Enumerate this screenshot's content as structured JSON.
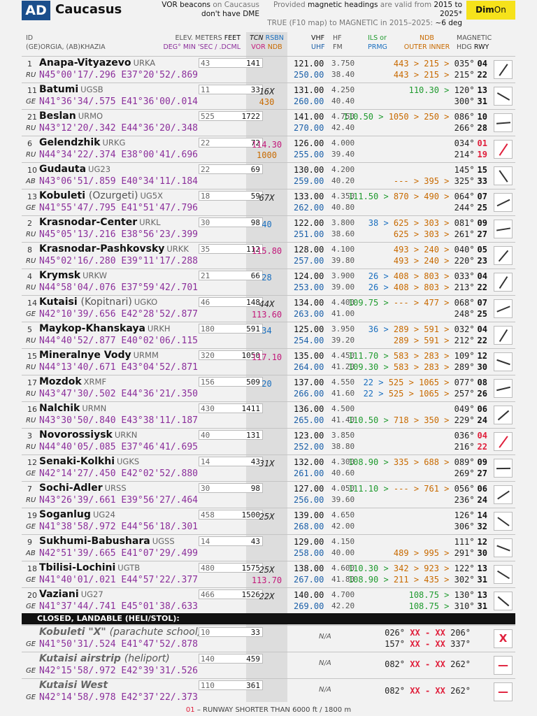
{
  "header": {
    "code": "AD",
    "title": "Caucasus",
    "vor_note_a": "VOR beacons",
    "vor_note_b": " on Caucasus",
    "vor_note_c": "don't have DME",
    "mag_note_a": "Provided ",
    "mag_note_b": "magnetic headings",
    "mag_note_c": " are valid from ",
    "mag_note_d": "2015 to 2025*",
    "mag_note_e": "TRUE (F10 map) to MAGNETIC in 2015–2025: ",
    "mag_note_f": "~6 deg",
    "dim_a": "Dim",
    "dim_b": "On"
  },
  "columns": {
    "id": "ID",
    "region": "(GE)ORGIA, (AB)KHAZIA",
    "elev": "ELEV. METERS",
    "feet": "FEET",
    "deg": "DEG° MIN 'SEC / .DCML",
    "tcn": "TCN",
    "rsbn": "RSBN",
    "vor": "VOR",
    "ndb": "NDB",
    "vhf": "VHF",
    "uhf": "UHF",
    "hf": "HF",
    "fm": "FM",
    "ils": "ILS or",
    "prmg": "PRMG",
    "ndb2": "NDB",
    "outer": "OUTER",
    "inner": "INNER",
    "magnetic": "MAGNETIC",
    "hdg": "HDG",
    "rwy": "RWY"
  },
  "airfields": [
    {
      "idx": "1",
      "name": "Anapa-Vityazevo",
      "icao": "URKA",
      "cc": "RU",
      "coord": "N45°00'17/.296  E37°20'52/.869",
      "m": "43",
      "ft": "141",
      "tcn": "",
      "rsbn": "",
      "vor": "",
      "ndb": "",
      "vhf": "121.00",
      "uhf": "250.00",
      "hf": "3.750",
      "fm": "38.40",
      "l1": "443 > 215 > 035°",
      "r1": "04",
      "l2": "443 > 215 > 215°",
      "r2": "22"
    },
    {
      "idx": "11",
      "name": "Batumi",
      "icao": "UGSB",
      "cc": "GE",
      "coord": "N41°36'34/.575  E41°36'00/.014",
      "m": "11",
      "ft": "33",
      "tcn": "16X",
      "rsbn": "",
      "vor": "",
      "ndb": "430",
      "vhf": "131.00",
      "uhf": "260.00",
      "hf": "4.250",
      "fm": "40.40",
      "l1": "110.30 > 120°",
      "r1": "13",
      "l2": "300°",
      "r2": "31"
    },
    {
      "idx": "21",
      "name": "Beslan",
      "icao": "URMO",
      "cc": "RU",
      "coord": "N43°12'20/.342  E44°36'20/.348",
      "m": "525",
      "ft": "1722",
      "tcn": "",
      "rsbn": "",
      "vor": "",
      "ndb": "",
      "vhf": "141.00",
      "uhf": "270.00",
      "hf": "4.750",
      "fm": "42.40",
      "l1": "110.50 > 1050 > 250 > 086°",
      "r1": "10",
      "l2": "266°",
      "r2": "28"
    },
    {
      "idx": "6",
      "name": "Gelendzhik",
      "icao": "URKG",
      "cc": "RU",
      "coord": "N44°34'22/.374  E38°00'41/.696",
      "m": "22",
      "ft": "72",
      "tcn": "",
      "rsbn": "",
      "vor": "114.30",
      "ndb": "1000",
      "vhf": "126.00",
      "uhf": "255.00",
      "hf": "4.000",
      "fm": "39.40",
      "l1": "034°",
      "r1": "01",
      "l2": "214°",
      "r2": "19",
      "short": true
    },
    {
      "idx": "10",
      "name": "Gudauta",
      "icao": "UG23",
      "cc": "AB",
      "coord": "N43°06'51/.859  E40°34'11/.184",
      "m": "22",
      "ft": "69",
      "tcn": "",
      "rsbn": "",
      "vor": "",
      "ndb": "",
      "vhf": "130.00",
      "uhf": "259.00",
      "hf": "4.200",
      "fm": "40.20",
      "l1": "145°",
      "r1": "15",
      "l2": "--- > 395 > 325°",
      "r2": "33"
    },
    {
      "idx": "13",
      "name": "Kobuleti",
      "alt": "(Ozurgeti)",
      "icao": "UG5X",
      "cc": "GE",
      "coord": "N41°55'47/.795  E41°51'47/.796",
      "m": "18",
      "ft": "59",
      "tcn": "67X",
      "rsbn": "",
      "vor": "",
      "ndb": "",
      "vhf": "133.00",
      "uhf": "262.00",
      "hf": "4.350",
      "fm": "40.80",
      "l1": "111.50 > 870 > 490 > 064°",
      "r1": "07",
      "l2": "244°",
      "r2": "25"
    },
    {
      "idx": "2",
      "name": "Krasnodar-Center",
      "icao": "URKL",
      "cc": "RU",
      "coord": "N45°05'13/.216  E38°56'23/.399",
      "m": "30",
      "ft": "98",
      "tcn": "",
      "rsbn": "40",
      "vor": "",
      "ndb": "",
      "vhf": "122.00",
      "uhf": "251.00",
      "hf": "3.800",
      "fm": "38.60",
      "l1": "38 > 625 > 303 > 081°",
      "r1": "09",
      "l2": "625 > 303 > 261°",
      "r2": "27"
    },
    {
      "idx": "8",
      "name": "Krasnodar-Pashkovsky",
      "icao": "URKK",
      "cc": "RU",
      "coord": "N45°02'16/.280  E39°11'17/.288",
      "m": "35",
      "ft": "112",
      "tcn": "",
      "rsbn": "",
      "vor": "115.80",
      "ndb": "",
      "vhf": "128.00",
      "uhf": "257.00",
      "hf": "4.100",
      "fm": "39.80",
      "l1": "493 > 240 > 040°",
      "r1": "05",
      "l2": "493 > 240 > 220°",
      "r2": "23"
    },
    {
      "idx": "4",
      "name": "Krymsk",
      "icao": "URKW",
      "cc": "RU",
      "coord": "N44°58'04/.076  E37°59'42/.701",
      "m": "21",
      "ft": "66",
      "tcn": "",
      "rsbn": "28",
      "vor": "",
      "ndb": "",
      "vhf": "124.00",
      "uhf": "253.00",
      "hf": "3.900",
      "fm": "39.00",
      "l1": "26 > 408 > 803 > 033°",
      "r1": "04",
      "l2": "26 > 408 > 803 > 213°",
      "r2": "22"
    },
    {
      "idx": "14",
      "name": "Kutaisi",
      "alt": "(Kopitnari)",
      "icao": "UGKO",
      "cc": "GE",
      "coord": "N42°10'39/.656  E42°28'52/.877",
      "m": "46",
      "ft": "148",
      "tcn": "44X",
      "rsbn": "",
      "vor": "113.60",
      "ndb": "",
      "vhf": "134.00",
      "uhf": "263.00",
      "hf": "4.400",
      "fm": "41.00",
      "l1": "109.75 > --- > 477 > 068°",
      "r1": "07",
      "l2": "248°",
      "r2": "25"
    },
    {
      "idx": "5",
      "name": "Maykop-Khanskaya",
      "icao": "URKH",
      "cc": "RU",
      "coord": "N44°40'52/.877  E40°02'06/.115",
      "m": "180",
      "ft": "591",
      "tcn": "",
      "rsbn": "34",
      "vor": "",
      "ndb": "",
      "vhf": "125.00",
      "uhf": "254.00",
      "hf": "3.950",
      "fm": "39.20",
      "l1": "36 > 289 > 591 > 032°",
      "r1": "04",
      "l2": "289 > 591 > 212°",
      "r2": "22"
    },
    {
      "idx": "15",
      "name": "Mineralnye Vody",
      "icao": "URMM",
      "cc": "RU",
      "coord": "N44°13'40/.671  E43°04'52/.871",
      "m": "320",
      "ft": "1050",
      "tcn": "",
      "rsbn": "",
      "vor": "117.10",
      "ndb": "",
      "vhf": "135.00",
      "uhf": "264.00",
      "hf": "4.450",
      "fm": "41.20",
      "l1": "111.70 > 583 > 283 > 109°",
      "r1": "12",
      "l2": "109.30 > 583 > 283 > 289°",
      "r2": "30"
    },
    {
      "idx": "17",
      "name": "Mozdok",
      "icao": "XRMF",
      "cc": "RU",
      "coord": "N43°47'30/.502  E44°36'21/.350",
      "m": "156",
      "ft": "509",
      "tcn": "",
      "rsbn": "20",
      "vor": "",
      "ndb": "",
      "vhf": "137.00",
      "uhf": "266.00",
      "hf": "4.550",
      "fm": "41.60",
      "l1": "22 > 525 > 1065 > 077°",
      "r1": "08",
      "l2": "22 > 525 > 1065 > 257°",
      "r2": "26"
    },
    {
      "idx": "16",
      "name": "Nalchik",
      "icao": "URMN",
      "cc": "RU",
      "coord": "N43°30'50/.840  E43°38'11/.187",
      "m": "430",
      "ft": "1411",
      "tcn": "",
      "rsbn": "",
      "vor": "",
      "ndb": "",
      "vhf": "136.00",
      "uhf": "265.00",
      "hf": "4.500",
      "fm": "41.40",
      "l1": "049°",
      "r1": "06",
      "l2": "110.50 > 718 > 350 > 229°",
      "r2": "24"
    },
    {
      "idx": "3",
      "name": "Novorossiysk",
      "icao": "URKN",
      "cc": "RU",
      "coord": "N44°40'05/.085  E37°46'41/.695",
      "m": "40",
      "ft": "131",
      "tcn": "",
      "rsbn": "",
      "vor": "",
      "ndb": "",
      "vhf": "123.00",
      "uhf": "252.00",
      "hf": "3.850",
      "fm": "38.80",
      "l1": "036°",
      "r1": "04",
      "l2": "216°",
      "r2": "22",
      "short": true
    },
    {
      "idx": "12",
      "name": "Senaki-Kolkhi",
      "icao": "UGKS",
      "cc": "GE",
      "coord": "N42°14'27/.450  E42°02'52/.880",
      "m": "14",
      "ft": "43",
      "tcn": "31X",
      "rsbn": "",
      "vor": "",
      "ndb": "",
      "vhf": "132.00",
      "uhf": "261.00",
      "hf": "4.300",
      "fm": "40.60",
      "l1": "108.90 > 335 > 688 > 089°",
      "r1": "09",
      "l2": "269°",
      "r2": "27"
    },
    {
      "idx": "7",
      "name": "Sochi-Adler",
      "icao": "URSS",
      "cc": "RU",
      "coord": "N43°26'39/.661  E39°56'27/.464",
      "m": "30",
      "ft": "98",
      "tcn": "",
      "rsbn": "",
      "vor": "",
      "ndb": "",
      "vhf": "127.00",
      "uhf": "256.00",
      "hf": "4.050",
      "fm": "39.60",
      "l1": "111.10 > --- > 761 > 056°",
      "r1": "06",
      "l2": "236°",
      "r2": "24"
    },
    {
      "idx": "19",
      "name": "Soganlug",
      "icao": "UG24",
      "cc": "GE",
      "coord": "N41°38'58/.972  E44°56'18/.301",
      "m": "458",
      "ft": "1500",
      "tcn": "25X",
      "rsbn": "",
      "vor": "",
      "ndb": "",
      "vhf": "139.00",
      "uhf": "268.00",
      "hf": "4.650",
      "fm": "42.00",
      "l1": "126°",
      "r1": "14",
      "l2": "306°",
      "r2": "32"
    },
    {
      "idx": "9",
      "name": "Sukhumi-Babushara",
      "icao": "UGSS",
      "cc": "AB",
      "coord": "N42°51'39/.665  E41°07'29/.499",
      "m": "14",
      "ft": "43",
      "tcn": "",
      "rsbn": "",
      "vor": "",
      "ndb": "",
      "vhf": "129.00",
      "uhf": "258.00",
      "hf": "4.150",
      "fm": "40.00",
      "l1": "111°",
      "r1": "12",
      "l2": "489 > 995 > 291°",
      "r2": "30"
    },
    {
      "idx": "18",
      "name": "Tbilisi-Lochini",
      "icao": "UGTB",
      "cc": "GE",
      "coord": "N41°40'01/.021  E44°57'22/.377",
      "m": "480",
      "ft": "1575",
      "tcn": "25X",
      "rsbn": "",
      "vor": "113.70",
      "ndb": "",
      "vhf": "138.00",
      "uhf": "267.00",
      "hf": "4.600",
      "fm": "41.80",
      "l1": "110.30 > 342 > 923 > 122°",
      "r1": "13",
      "l2": "108.90 > 211 > 435 > 302°",
      "r2": "31"
    },
    {
      "idx": "20",
      "name": "Vaziani",
      "icao": "UG27",
      "cc": "GE",
      "coord": "N41°37'44/.741  E45°01'38/.633",
      "m": "466",
      "ft": "1526",
      "tcn": "22X",
      "rsbn": "",
      "vor": "",
      "ndb": "",
      "vhf": "140.00",
      "uhf": "269.00",
      "hf": "4.700",
      "fm": "42.20",
      "l1": "108.75 > 130°",
      "r1": "13",
      "l2": "108.75 > 310°",
      "r2": "31"
    }
  ],
  "closed_title": "CLOSED, LANDABLE (HELI/STOL):",
  "closed": [
    {
      "name": "Kobuleti \"X\"",
      "alt": "(parachute school)",
      "cc": "GE",
      "coord": "N41°50'31/.524  E41°47'52/.878",
      "m": "10",
      "ft": "33",
      "na": "N/A",
      "l1a": "026°",
      "l1b": "206°",
      "l2a": "157°",
      "l2b": "337°",
      "xx": "XX",
      "dash": "-",
      "mark": "X"
    },
    {
      "name": "Kutaisi airstrip",
      "alt": "(heliport)",
      "cc": "GE",
      "coord": "N42°15'58/.972  E42°39'31/.526",
      "m": "140",
      "ft": "459",
      "na": "N/A",
      "l1a": "082°",
      "l1b": "262°",
      "xx": "XX",
      "dash": "-",
      "mark": "—"
    },
    {
      "name": "Kutaisi West",
      "alt": "",
      "cc": "GE",
      "coord": "N42°14'58/.978  E42°37'22/.373",
      "m": "110",
      "ft": "361",
      "na": "N/A",
      "l1a": "082°",
      "l1b": "262°",
      "xx": "XX",
      "dash": "-",
      "mark": "—"
    }
  ],
  "footer_num": "01",
  "footer_text": " – RUNWAY SHORTER THAN 6000 ft / 1800 m",
  "colors": {
    "logo": "#1a4e8c",
    "dim": "#f6e21b",
    "coord": "#8b2e9b",
    "ils": "#1f9a2e",
    "ndb": "#c86a00",
    "rsbn": "#1a6fbf",
    "vor": "#c2187a",
    "short": "#e0203c"
  }
}
